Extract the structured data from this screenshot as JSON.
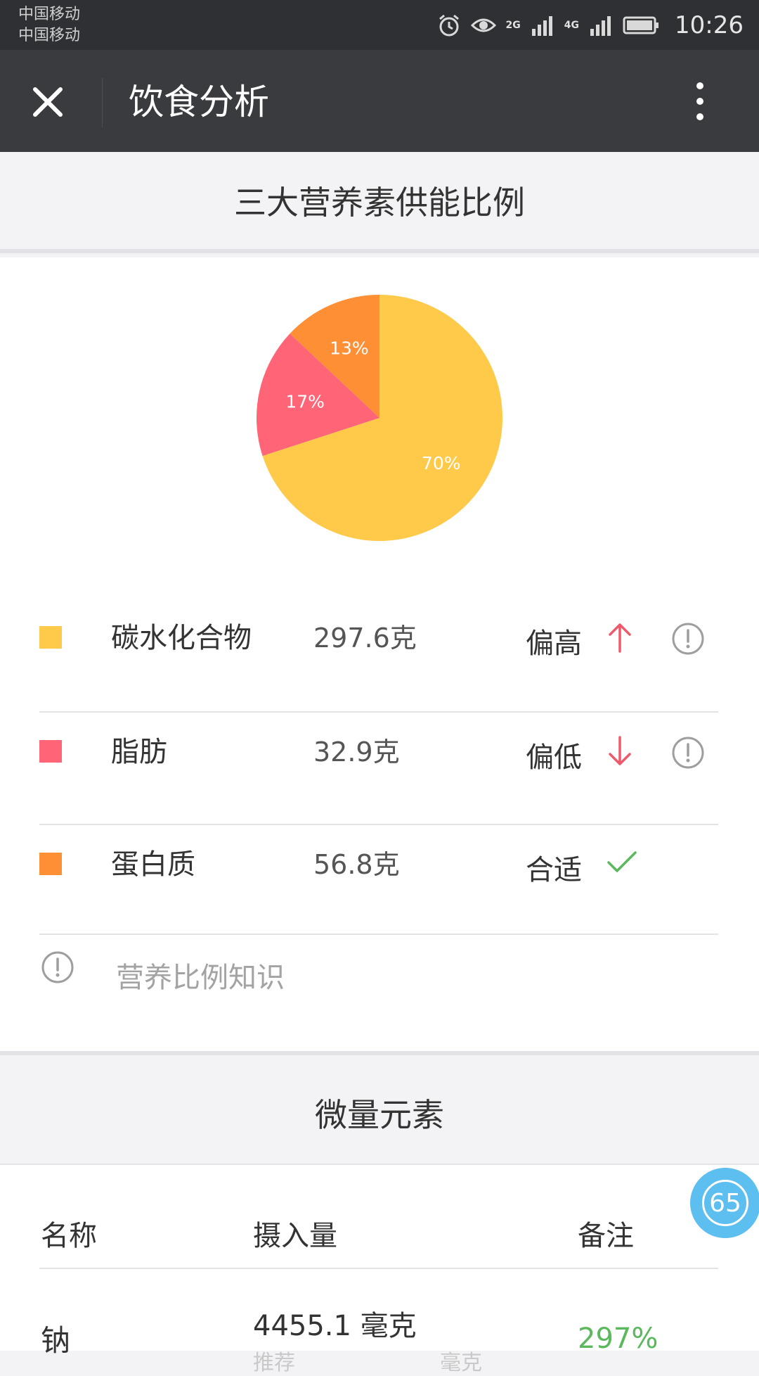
{
  "status_bar": {
    "carrier_1": "中国移动",
    "carrier_2": "中国移动",
    "network_1": "2G",
    "network_2": "4G",
    "time": "10:26",
    "icons": [
      "alarm-icon",
      "eye-icon",
      "signal-icon",
      "battery-icon"
    ]
  },
  "header": {
    "title": "饮食分析",
    "close_icon": "close-icon",
    "more_icon": "more-vertical-icon"
  },
  "macro_section": {
    "title": "三大营养素供能比例"
  },
  "chart_data": {
    "type": "pie",
    "slices": [
      {
        "label": "碳水化合物",
        "value": 70,
        "display": "70%",
        "color": "#ffc94a"
      },
      {
        "label": "脂肪",
        "value": 17,
        "display": "17%",
        "color": "#ff6577"
      },
      {
        "label": "蛋白质",
        "value": 13,
        "display": "13%",
        "color": "#fe8f35"
      }
    ]
  },
  "nutrients": [
    {
      "name": "碳水化合物",
      "amount": "297.6克",
      "status": "偏高",
      "trend": "up",
      "color": "#ffc94a",
      "has_info": true
    },
    {
      "name": "脂肪",
      "amount": "32.9克",
      "status": "偏低",
      "trend": "down",
      "color": "#ff6577",
      "has_info": true
    },
    {
      "name": "蛋白质",
      "amount": "56.8克",
      "status": "合适",
      "trend": "ok",
      "color": "#fe8f35",
      "has_info": false
    }
  ],
  "tip": {
    "text": "营养比例知识"
  },
  "micro_section": {
    "title": "微量元素",
    "columns": [
      "名称",
      "摄入量",
      "备注"
    ],
    "rows": [
      {
        "name": "钠",
        "amount": "4455.1 毫克",
        "sub_left": "推荐",
        "sub_right": "毫克",
        "note": "297%"
      }
    ]
  },
  "badge": {
    "count": "65"
  },
  "colors": {
    "up_arrow": "#f0596b",
    "down_arrow": "#f0596b",
    "ok_check": "#5cb85c",
    "info_icon": "#9e9e9e"
  }
}
